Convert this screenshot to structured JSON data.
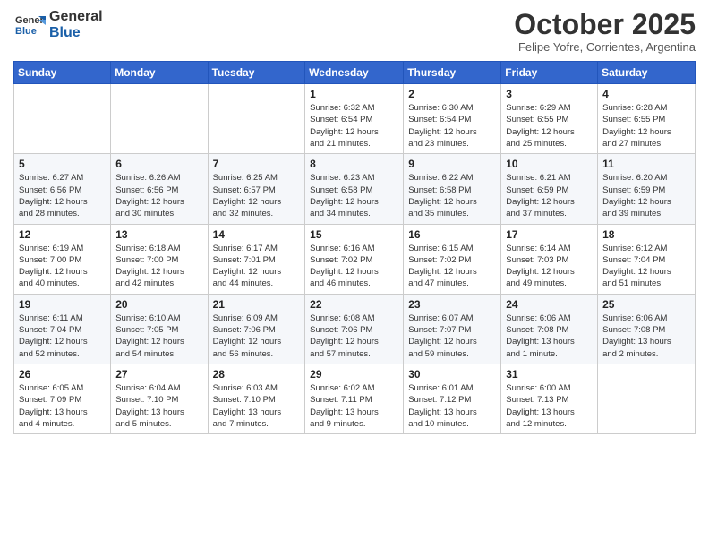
{
  "header": {
    "logo_general": "General",
    "logo_blue": "Blue",
    "month": "October 2025",
    "location": "Felipe Yofre, Corrientes, Argentina"
  },
  "weekdays": [
    "Sunday",
    "Monday",
    "Tuesday",
    "Wednesday",
    "Thursday",
    "Friday",
    "Saturday"
  ],
  "weeks": [
    [
      {
        "day": "",
        "info": ""
      },
      {
        "day": "",
        "info": ""
      },
      {
        "day": "",
        "info": ""
      },
      {
        "day": "1",
        "info": "Sunrise: 6:32 AM\nSunset: 6:54 PM\nDaylight: 12 hours\nand 21 minutes."
      },
      {
        "day": "2",
        "info": "Sunrise: 6:30 AM\nSunset: 6:54 PM\nDaylight: 12 hours\nand 23 minutes."
      },
      {
        "day": "3",
        "info": "Sunrise: 6:29 AM\nSunset: 6:55 PM\nDaylight: 12 hours\nand 25 minutes."
      },
      {
        "day": "4",
        "info": "Sunrise: 6:28 AM\nSunset: 6:55 PM\nDaylight: 12 hours\nand 27 minutes."
      }
    ],
    [
      {
        "day": "5",
        "info": "Sunrise: 6:27 AM\nSunset: 6:56 PM\nDaylight: 12 hours\nand 28 minutes."
      },
      {
        "day": "6",
        "info": "Sunrise: 6:26 AM\nSunset: 6:56 PM\nDaylight: 12 hours\nand 30 minutes."
      },
      {
        "day": "7",
        "info": "Sunrise: 6:25 AM\nSunset: 6:57 PM\nDaylight: 12 hours\nand 32 minutes."
      },
      {
        "day": "8",
        "info": "Sunrise: 6:23 AM\nSunset: 6:58 PM\nDaylight: 12 hours\nand 34 minutes."
      },
      {
        "day": "9",
        "info": "Sunrise: 6:22 AM\nSunset: 6:58 PM\nDaylight: 12 hours\nand 35 minutes."
      },
      {
        "day": "10",
        "info": "Sunrise: 6:21 AM\nSunset: 6:59 PM\nDaylight: 12 hours\nand 37 minutes."
      },
      {
        "day": "11",
        "info": "Sunrise: 6:20 AM\nSunset: 6:59 PM\nDaylight: 12 hours\nand 39 minutes."
      }
    ],
    [
      {
        "day": "12",
        "info": "Sunrise: 6:19 AM\nSunset: 7:00 PM\nDaylight: 12 hours\nand 40 minutes."
      },
      {
        "day": "13",
        "info": "Sunrise: 6:18 AM\nSunset: 7:00 PM\nDaylight: 12 hours\nand 42 minutes."
      },
      {
        "day": "14",
        "info": "Sunrise: 6:17 AM\nSunset: 7:01 PM\nDaylight: 12 hours\nand 44 minutes."
      },
      {
        "day": "15",
        "info": "Sunrise: 6:16 AM\nSunset: 7:02 PM\nDaylight: 12 hours\nand 46 minutes."
      },
      {
        "day": "16",
        "info": "Sunrise: 6:15 AM\nSunset: 7:02 PM\nDaylight: 12 hours\nand 47 minutes."
      },
      {
        "day": "17",
        "info": "Sunrise: 6:14 AM\nSunset: 7:03 PM\nDaylight: 12 hours\nand 49 minutes."
      },
      {
        "day": "18",
        "info": "Sunrise: 6:12 AM\nSunset: 7:04 PM\nDaylight: 12 hours\nand 51 minutes."
      }
    ],
    [
      {
        "day": "19",
        "info": "Sunrise: 6:11 AM\nSunset: 7:04 PM\nDaylight: 12 hours\nand 52 minutes."
      },
      {
        "day": "20",
        "info": "Sunrise: 6:10 AM\nSunset: 7:05 PM\nDaylight: 12 hours\nand 54 minutes."
      },
      {
        "day": "21",
        "info": "Sunrise: 6:09 AM\nSunset: 7:06 PM\nDaylight: 12 hours\nand 56 minutes."
      },
      {
        "day": "22",
        "info": "Sunrise: 6:08 AM\nSunset: 7:06 PM\nDaylight: 12 hours\nand 57 minutes."
      },
      {
        "day": "23",
        "info": "Sunrise: 6:07 AM\nSunset: 7:07 PM\nDaylight: 12 hours\nand 59 minutes."
      },
      {
        "day": "24",
        "info": "Sunrise: 6:06 AM\nSunset: 7:08 PM\nDaylight: 13 hours\nand 1 minute."
      },
      {
        "day": "25",
        "info": "Sunrise: 6:06 AM\nSunset: 7:08 PM\nDaylight: 13 hours\nand 2 minutes."
      }
    ],
    [
      {
        "day": "26",
        "info": "Sunrise: 6:05 AM\nSunset: 7:09 PM\nDaylight: 13 hours\nand 4 minutes."
      },
      {
        "day": "27",
        "info": "Sunrise: 6:04 AM\nSunset: 7:10 PM\nDaylight: 13 hours\nand 5 minutes."
      },
      {
        "day": "28",
        "info": "Sunrise: 6:03 AM\nSunset: 7:10 PM\nDaylight: 13 hours\nand 7 minutes."
      },
      {
        "day": "29",
        "info": "Sunrise: 6:02 AM\nSunset: 7:11 PM\nDaylight: 13 hours\nand 9 minutes."
      },
      {
        "day": "30",
        "info": "Sunrise: 6:01 AM\nSunset: 7:12 PM\nDaylight: 13 hours\nand 10 minutes."
      },
      {
        "day": "31",
        "info": "Sunrise: 6:00 AM\nSunset: 7:13 PM\nDaylight: 13 hours\nand 12 minutes."
      },
      {
        "day": "",
        "info": ""
      }
    ]
  ]
}
